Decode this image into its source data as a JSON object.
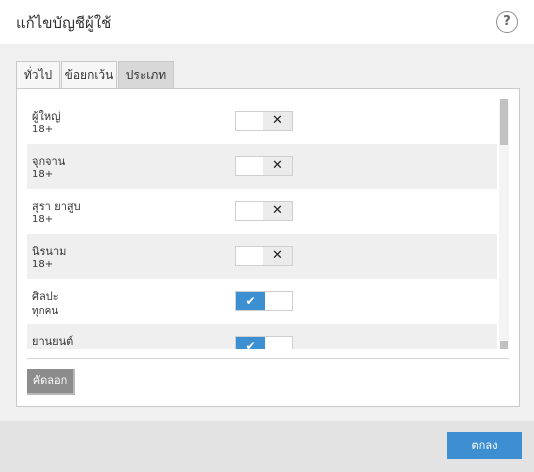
{
  "dialog": {
    "title": "แก้ไขบัญชีผู้ใช้",
    "help_label": "?"
  },
  "tabs": [
    {
      "label": "ทั่วไป",
      "active": false
    },
    {
      "label": "ข้อยกเว้น",
      "active": false
    },
    {
      "label": "ประเภท",
      "active": true
    }
  ],
  "categories": [
    {
      "name": "ผู้ใหญ่",
      "rating": "18+",
      "allowed": false
    },
    {
      "name": "จุกจาน",
      "rating": "18+",
      "allowed": false
    },
    {
      "name": "สุรา ยาสูบ",
      "rating": "18+",
      "allowed": false
    },
    {
      "name": "นิรนาม",
      "rating": "18+",
      "allowed": false
    },
    {
      "name": "ศิลปะ",
      "rating": "ทุกคน",
      "allowed": true
    },
    {
      "name": "ยานยนต์",
      "rating": "",
      "allowed": true
    }
  ],
  "icons": {
    "blocked": "✕",
    "allowed": "✔"
  },
  "colors": {
    "accent": "#3c8fd0",
    "copy_button": "#8c8c8c"
  },
  "buttons": {
    "copy": "คัดลอก",
    "ok": "ตกลง"
  }
}
